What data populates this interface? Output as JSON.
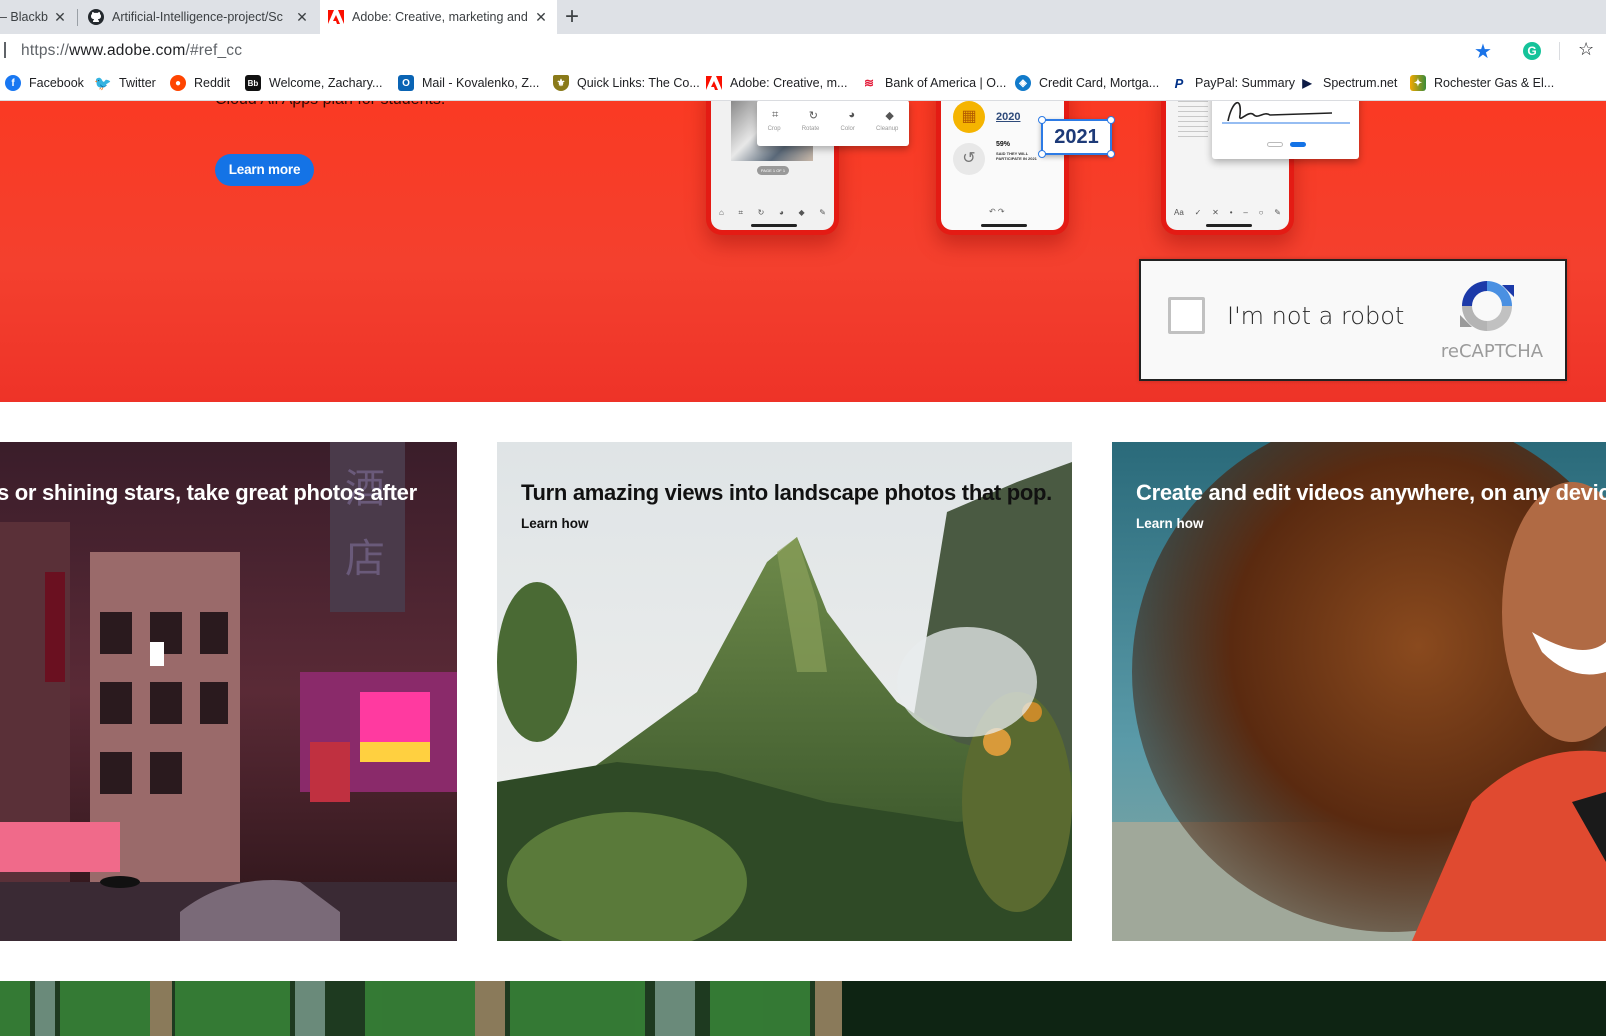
{
  "browser": {
    "tabs": [
      {
        "title": "– Blackb",
        "close": "✕"
      },
      {
        "title": "Artificial-Intelligence-project/Sc",
        "close": "✕"
      },
      {
        "title": "Adobe: Creative, marketing and",
        "close": "✕"
      }
    ],
    "new_tab": "+",
    "url_prefix": "https://",
    "url_domain": "www.adobe.com",
    "url_path": "/#ref_cc",
    "bookmark_star_icon": "star-filled",
    "extension_label": "G",
    "reading_list_icon": "star-list"
  },
  "bookmarks": [
    {
      "label": "Facebook",
      "icon": "facebook-icon",
      "color": "#1877f2"
    },
    {
      "label": "Twitter",
      "icon": "twitter-icon",
      "color": "#1da1f2"
    },
    {
      "label": "Reddit",
      "icon": "reddit-icon",
      "color": "#ff4500"
    },
    {
      "label": "Welcome, Zachary...",
      "icon": "blackboard-icon",
      "color": "#111111"
    },
    {
      "label": "Mail - Kovalenko, Z...",
      "icon": "outlook-icon",
      "color": "#0a64b4"
    },
    {
      "label": "Quick Links: The Co...",
      "icon": "shield-icon",
      "color": "#8a7a1a"
    },
    {
      "label": "Adobe: Creative, m...",
      "icon": "adobe-icon",
      "color": "#fa0f00"
    },
    {
      "label": "Bank of America | O...",
      "icon": "bofa-icon",
      "color": "#e31837"
    },
    {
      "label": "Credit Card, Mortga...",
      "icon": "chase-icon",
      "color": "#117aca"
    },
    {
      "label": "PayPal: Summary",
      "icon": "paypal-icon",
      "color": "#003087"
    },
    {
      "label": "Spectrum.net",
      "icon": "spectrum-icon",
      "color": "#0d1b45"
    },
    {
      "label": "Rochester Gas & El...",
      "icon": "rge-icon",
      "color": "#f2a900"
    }
  ],
  "hero": {
    "subtitle_fragment": "Cloud All Apps plan for students.",
    "learn_more": "Learn more",
    "phone_scan_tools": [
      "Crop",
      "Rotate",
      "Color",
      "Cleanup"
    ],
    "phone_scan_page": "PAGE 1 OF 1",
    "phone_fill_year_old": "2020",
    "phone_fill_year_new": "2021",
    "phone_fill_stat": "59%",
    "phone_fill_caption": "SAID THEY WILL PARTICIPATE IN 2021",
    "accent_color": "#fa3a23"
  },
  "recaptcha": {
    "label": "I'm not a robot",
    "brand": "reCAPTCHA"
  },
  "cards": [
    {
      "title": "s or shining stars, take great photos after",
      "link": ""
    },
    {
      "title": "Turn amazing views into landscape photos that pop.",
      "link": "Learn how"
    },
    {
      "title": "Create and edit videos anywhere, on any devic",
      "link": "Learn how"
    }
  ]
}
